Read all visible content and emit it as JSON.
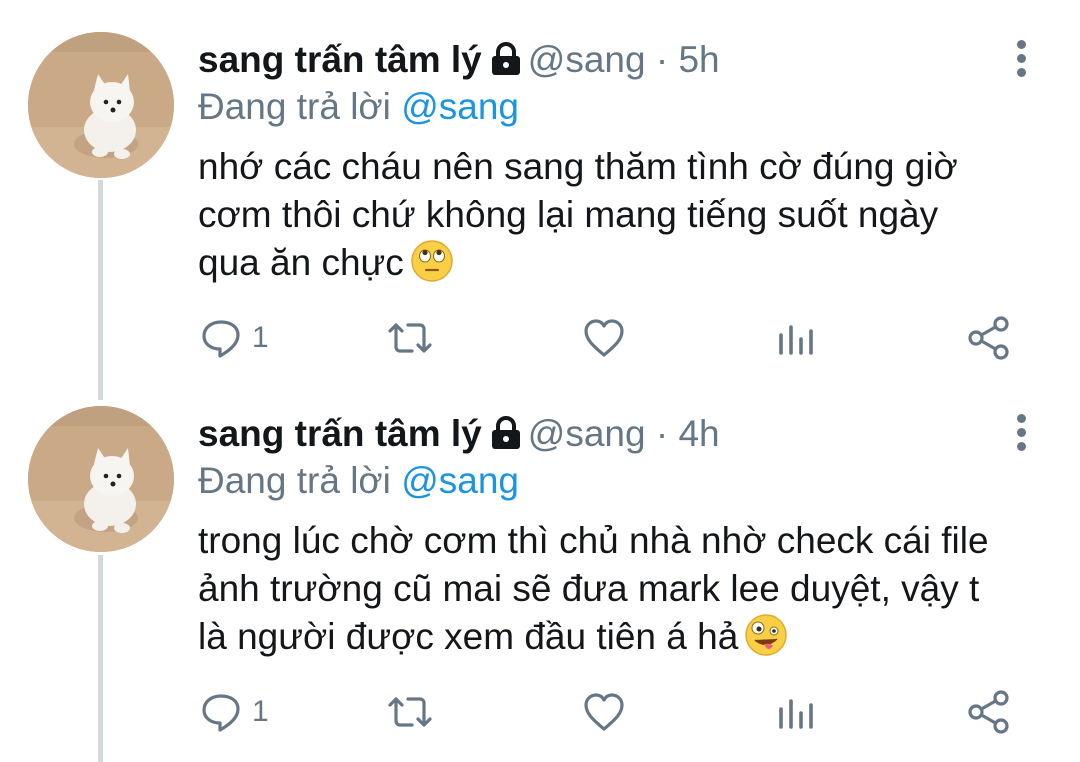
{
  "tweets": [
    {
      "display_name": "sang trấn tâm lý",
      "handle": "@sang",
      "time": "· 5h",
      "reply_prefix": "Đang trả lời",
      "reply_mention": "@sang",
      "lines": [
        "nhớ các cháu nên sang thăm tình cờ đúng giờ",
        "cơm thôi chứ không lại mang tiếng suốt ngày",
        "qua ăn chực"
      ],
      "emoji": "eye-roll-emoji",
      "reply_count": "1"
    },
    {
      "display_name": "sang trấn tâm lý",
      "handle": "@sang",
      "time": "· 4h",
      "reply_prefix": "Đang trả lời",
      "reply_mention": "@sang",
      "lines": [
        "trong lúc chờ cơm thì chủ nhà nhờ check cái file",
        "ảnh trường cũ mai sẽ đưa mark lee duyệt, vậy t",
        "là người được xem đầu tiên á hả"
      ],
      "emoji": "zany-face-emoji",
      "reply_count": "1"
    }
  ],
  "colors": {
    "text": "#14171a",
    "muted": "#657786",
    "link": "#1b95e0",
    "thread_line": "#cfd9de"
  },
  "icons": [
    "lock-icon",
    "more-icon",
    "reply-icon",
    "retweet-icon",
    "like-icon",
    "analytics-icon",
    "share-icon"
  ]
}
